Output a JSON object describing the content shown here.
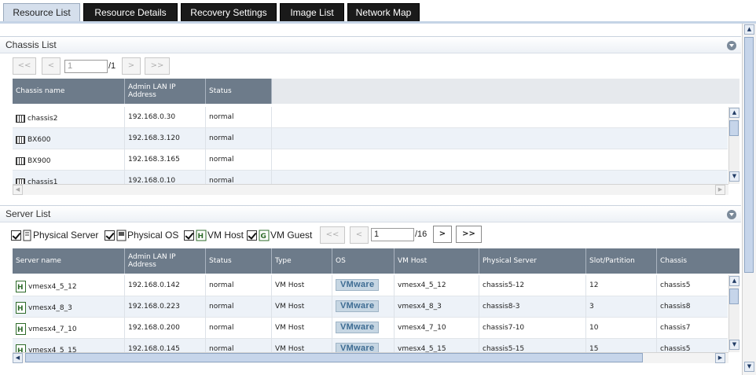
{
  "tabs": [
    {
      "label": "Resource List",
      "active": true
    },
    {
      "label": "Resource Details",
      "active": false
    },
    {
      "label": "Recovery Settings",
      "active": false
    },
    {
      "label": "Image List",
      "active": false
    },
    {
      "label": "Network Map",
      "active": false
    }
  ],
  "chassis_list": {
    "title": "Chassis List",
    "pager": {
      "first": "<<",
      "prev": "<",
      "page": "1",
      "total": "/1",
      "next": ">",
      "last": ">>"
    },
    "columns": [
      "Chassis name",
      "Admin LAN IP Address",
      "Status"
    ],
    "rows": [
      {
        "name": "chassis2",
        "ip": "192.168.0.30",
        "status": "normal"
      },
      {
        "name": "BX600",
        "ip": "192.168.3.120",
        "status": "normal"
      },
      {
        "name": "BX900",
        "ip": "192.168.3.165",
        "status": "normal"
      },
      {
        "name": "chassis1",
        "ip": "192.168.0.10",
        "status": "normal"
      }
    ]
  },
  "server_list": {
    "title": "Server List",
    "filters": [
      {
        "label": "Physical Server",
        "checked": true,
        "icon": "physical-server-icon"
      },
      {
        "label": "Physical OS",
        "checked": true,
        "icon": "physical-os-icon"
      },
      {
        "label": "VM Host",
        "checked": true,
        "icon": "vm-host-icon"
      },
      {
        "label": "VM Guest",
        "checked": true,
        "icon": "vm-guest-icon"
      }
    ],
    "pager": {
      "first": "<<",
      "prev": "<",
      "page": "1",
      "total": "/16",
      "next": ">",
      "last": ">>"
    },
    "columns": [
      "Server name",
      "Admin LAN IP Address",
      "Status",
      "Type",
      "OS",
      "VM Host",
      "Physical Server",
      "Slot/Partition",
      "Chassis"
    ],
    "rows": [
      {
        "name": "vmesx4_5_12",
        "ip": "192.168.0.142",
        "status": "normal",
        "type": "VM Host",
        "os": "VMware",
        "vmhost": "vmesx4_5_12",
        "physical": "chassis5-12",
        "slot": "12",
        "chassis": "chassis5"
      },
      {
        "name": "vmesx4_8_3",
        "ip": "192.168.0.223",
        "status": "normal",
        "type": "VM Host",
        "os": "VMware",
        "vmhost": "vmesx4_8_3",
        "physical": "chassis8-3",
        "slot": "3",
        "chassis": "chassis8"
      },
      {
        "name": "vmesx4_7_10",
        "ip": "192.168.0.200",
        "status": "normal",
        "type": "VM Host",
        "os": "VMware",
        "vmhost": "vmesx4_7_10",
        "physical": "chassis7-10",
        "slot": "10",
        "chassis": "chassis7"
      },
      {
        "name": "vmesx4_5_15",
        "ip": "192.168.0.145",
        "status": "normal",
        "type": "VM Host",
        "os": "VMware",
        "vmhost": "vmesx4_5_15",
        "physical": "chassis5-15",
        "slot": "15",
        "chassis": "chassis5"
      }
    ]
  },
  "colors": {
    "tab_bg": "#1a1a1a",
    "tab_active_bg": "#d5dfec",
    "grid_header": "#6d7b8a",
    "row_alt": "#edf2f8"
  }
}
